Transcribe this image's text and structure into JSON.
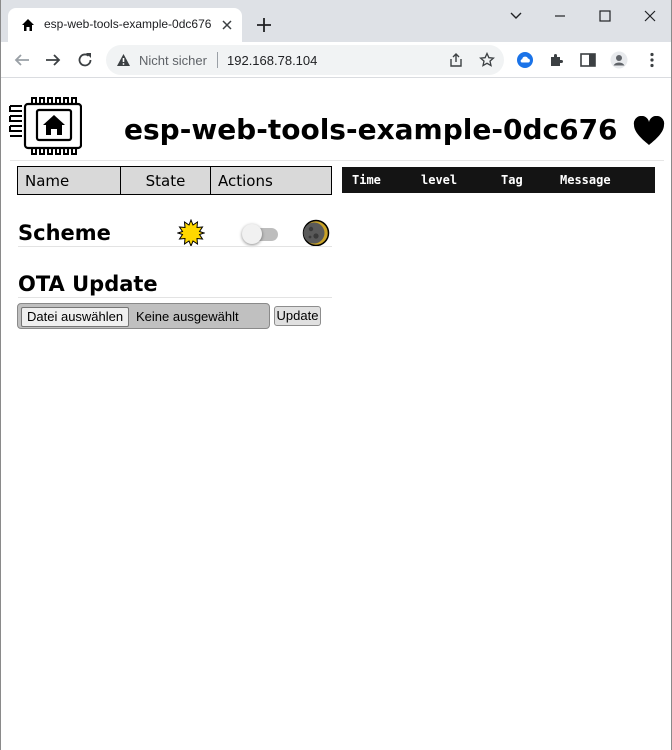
{
  "browser": {
    "tab": {
      "title": "esp-web-tools-example-0dc676",
      "favicon": "house-icon"
    },
    "address_bar": {
      "security_status": "Nicht sicher",
      "url": "192.168.78.104"
    },
    "icons": [
      "back-icon",
      "forward-icon",
      "reload-icon",
      "warning-icon",
      "share-icon",
      "bookmark-star-icon",
      "extension-cloud-icon",
      "extensions-puzzle-icon",
      "side-panel-icon",
      "profile-icon",
      "menu-icon",
      "minimize-icon",
      "maximize-icon",
      "close-icon",
      "chevron-down-icon",
      "new-tab-icon"
    ]
  },
  "page": {
    "title": "esp-web-tools-example-0dc676",
    "logo_icon": "chip-house-logo",
    "heart_icon": "heart-icon",
    "entity_table": {
      "headers": [
        "Name",
        "State",
        "Actions"
      ]
    },
    "log_table": {
      "headers": [
        "Time",
        "level",
        "Tag",
        "Message"
      ]
    },
    "scheme": {
      "heading": "Scheme",
      "light_icon": "sun-icon",
      "dark_icon": "moon-icon",
      "dark_mode_enabled": false
    },
    "ota": {
      "heading": "OTA Update",
      "file_button_label": "Datei auswählen",
      "file_status": "Keine ausgewählt",
      "update_button_label": "Update"
    }
  },
  "colors": {
    "tabstrip": "#dee1e6",
    "omnibox": "#f1f3f4",
    "log_header_bg": "#141414",
    "table_header_bg": "#d9d9d9",
    "sun": "#ffd700"
  }
}
